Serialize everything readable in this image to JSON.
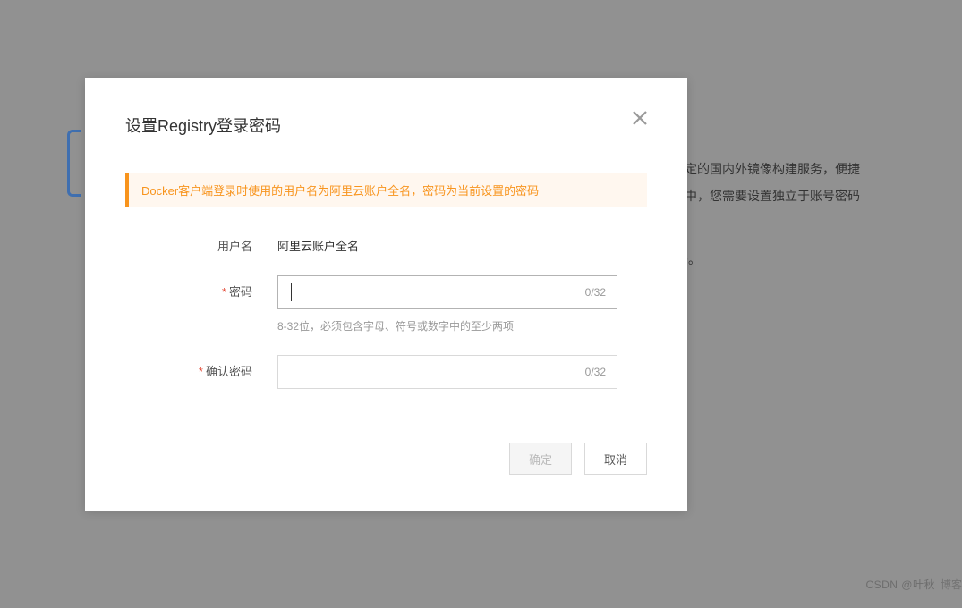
{
  "background": {
    "line1": "定的国内外镜像构建服务，便捷",
    "line2": "中，您需要设置独立于账号密码",
    "line3": "码。"
  },
  "modal": {
    "title": "设置Registry登录密码",
    "notice": "Docker客户端登录时使用的用户名为阿里云账户全名，密码为当前设置的密码",
    "username_label": "用户名",
    "username_value": "阿里云账户全名",
    "password_label": "密码",
    "password_value": "",
    "password_counter": "0/32",
    "password_hint": "8-32位，必须包含字母、符号或数字中的至少两项",
    "confirm_label": "确认密码",
    "confirm_value": "",
    "confirm_counter": "0/32",
    "confirm_btn": "确定",
    "cancel_btn": "取消"
  },
  "watermark": {
    "text1": "CSDN @叶秋",
    "text2": "博客"
  }
}
